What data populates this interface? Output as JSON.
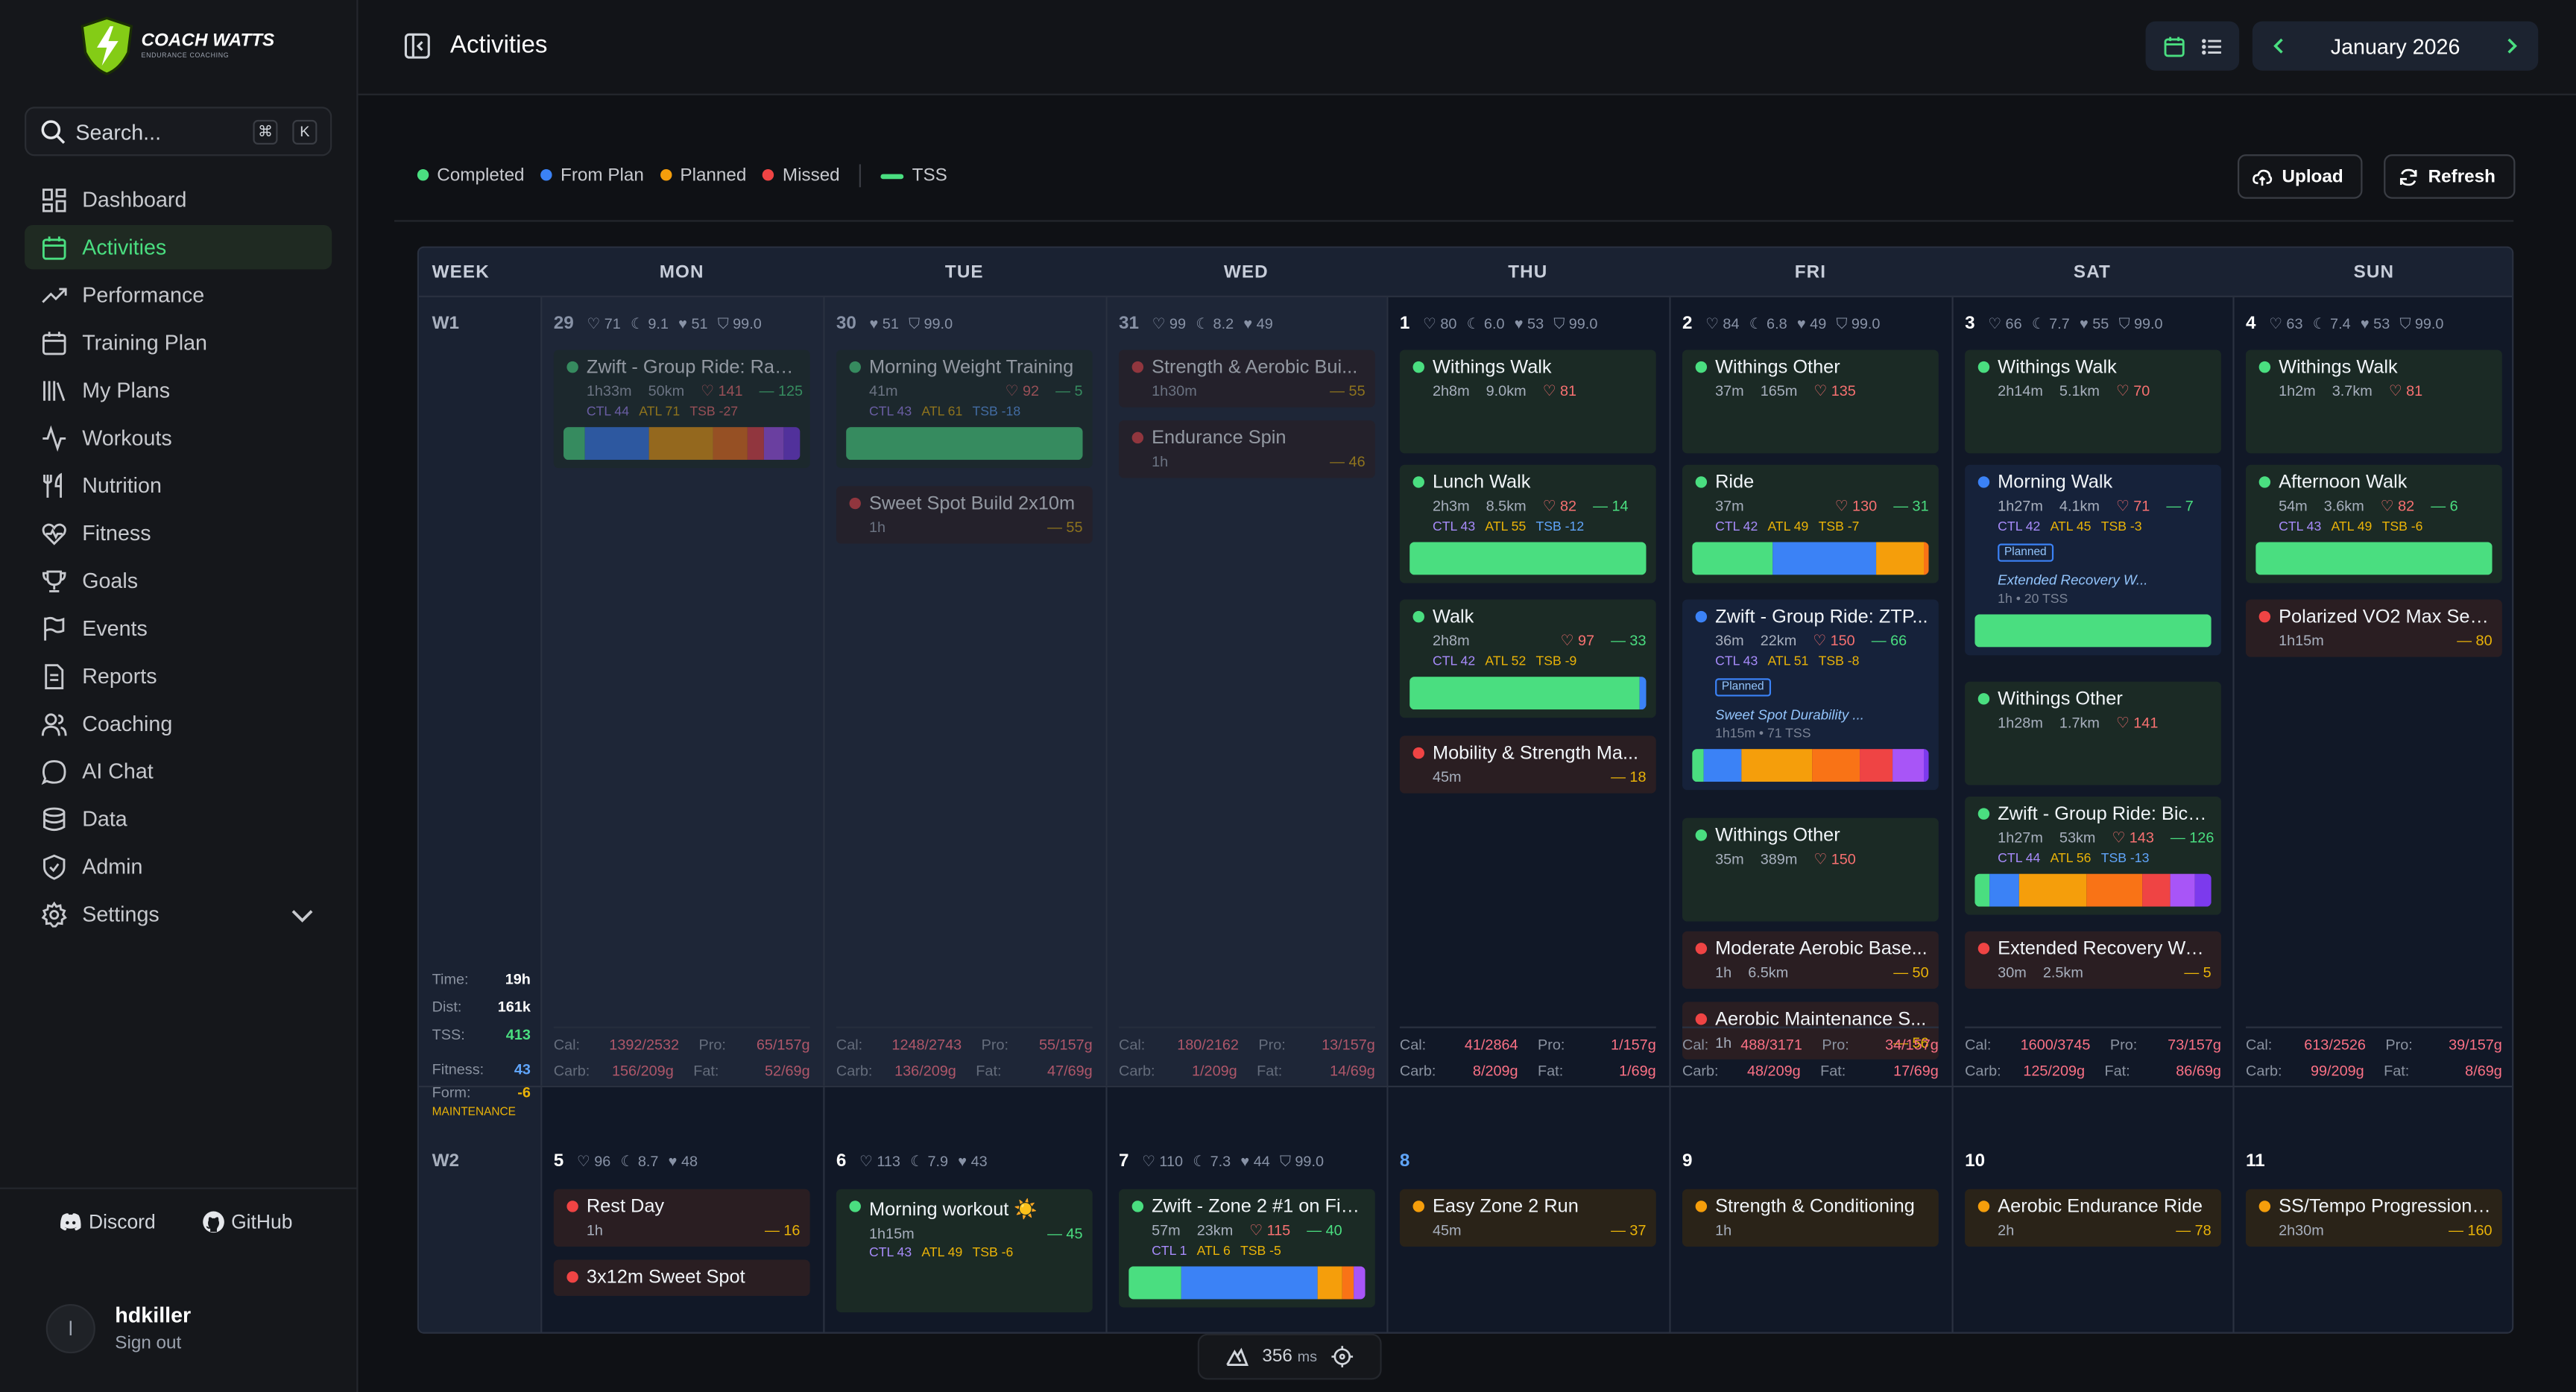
{
  "app": {
    "logo_title": "COACH WATTS",
    "logo_sub": "ENDURANCE COACHING"
  },
  "search": {
    "placeholder": "Search...",
    "kbd1": "⌘",
    "kbd2": "K"
  },
  "nav": [
    {
      "label": "Dashboard",
      "icon": "dashboard-icon"
    },
    {
      "label": "Activities",
      "icon": "calendar-icon",
      "active": true
    },
    {
      "label": "Performance",
      "icon": "trend-icon"
    },
    {
      "label": "Training Plan",
      "icon": "calendar-icon"
    },
    {
      "label": "My Plans",
      "icon": "library-icon"
    },
    {
      "label": "Workouts",
      "icon": "pulse-icon"
    },
    {
      "label": "Nutrition",
      "icon": "utensils-icon"
    },
    {
      "label": "Fitness",
      "icon": "heart-pulse-icon"
    },
    {
      "label": "Goals",
      "icon": "trophy-icon"
    },
    {
      "label": "Events",
      "icon": "flag-icon"
    },
    {
      "label": "Reports",
      "icon": "report-icon"
    },
    {
      "label": "Coaching",
      "icon": "users-icon"
    },
    {
      "label": "AI Chat",
      "icon": "chat-icon"
    },
    {
      "label": "Data",
      "icon": "database-icon"
    },
    {
      "label": "Admin",
      "icon": "shield-icon"
    },
    {
      "label": "Settings",
      "icon": "gear-icon"
    }
  ],
  "links": {
    "discord": "Discord",
    "github": "GitHub"
  },
  "user": {
    "initial": "l",
    "name": "hdkiller",
    "signout": "Sign out"
  },
  "header": {
    "title": "Activities",
    "month": "January 2026"
  },
  "legend": {
    "completed": "Completed",
    "from_plan": "From Plan",
    "planned": "Planned",
    "missed": "Missed",
    "tss": "TSS"
  },
  "buttons": {
    "upload": "Upload",
    "refresh": "Refresh"
  },
  "days": [
    "WEEK",
    "MON",
    "TUE",
    "WED",
    "THU",
    "FRI",
    "SAT",
    "SUN"
  ],
  "colors": {
    "completed": "#4ade80",
    "from_plan": "#3b82f6",
    "planned": "#f59e0b",
    "missed": "#ef4444"
  },
  "week1": {
    "label": "W1",
    "stats": {
      "time_l": "Time:",
      "time": "19h",
      "dist_l": "Dist:",
      "dist": "161k",
      "tss_l": "TSS:",
      "tss": "413",
      "fit_l": "Fitness:",
      "fit": "43",
      "form_l": "Form:",
      "form": "-6",
      "status": "MAINTENANCE"
    },
    "daynums": [
      {
        "n": "29",
        "m": [
          "♡ 71",
          "☾ 9.1",
          "♥ 51",
          "⛉ 99.0"
        ]
      },
      {
        "n": "30",
        "m": [
          "♥ 51",
          "⛉ 99.0"
        ]
      },
      {
        "n": "31",
        "m": [
          "♡ 99",
          "☾ 8.2",
          "♥ 49"
        ]
      },
      {
        "n": "1",
        "m": [
          "♡ 80",
          "☾ 6.0",
          "♥ 53",
          "⛉ 99.0"
        ]
      },
      {
        "n": "2",
        "m": [
          "♡ 84",
          "☾ 6.8",
          "♥ 49",
          "⛉ 99.0"
        ]
      },
      {
        "n": "3",
        "m": [
          "♡ 66",
          "☾ 7.7",
          "♥ 55",
          "⛉ 99.0"
        ]
      },
      {
        "n": "4",
        "m": [
          "♡ 63",
          "☾ 7.4",
          "♥ 53",
          "⛉ 99.0"
        ]
      }
    ],
    "nutrition": [
      {
        "cal": "1392/2532",
        "pro": "65/157g",
        "carb": "156/209g",
        "fat": "52/69g"
      },
      {
        "cal": "1248/2743",
        "pro": "55/157g",
        "carb": "136/209g",
        "fat": "47/69g"
      },
      {
        "cal": "180/2162",
        "pro": "13/157g",
        "carb": "1/209g",
        "fat": "14/69g"
      },
      {
        "cal": "41/2864",
        "pro": "1/157g",
        "carb": "8/209g",
        "fat": "1/69g"
      },
      {
        "cal": "488/3171",
        "pro": "34/157g",
        "carb": "48/209g",
        "fat": "17/69g"
      },
      {
        "cal": "1600/3745",
        "pro": "73/157g",
        "carb": "125/209g",
        "fat": "86/69g"
      },
      {
        "cal": "613/2526",
        "pro": "39/157g",
        "carb": "99/209g",
        "fat": "8/69g"
      }
    ],
    "nutr_labels": {
      "cal": "Cal:",
      "pro": "Pro:",
      "carb": "Carb:",
      "fat": "Fat:"
    }
  },
  "cards": {
    "mon1": {
      "title": "Zwift - Group Ride: Rap...",
      "dur": "1h33m",
      "dist": "50km",
      "hr": "♡ 141",
      "tss": "— 125",
      "ctl": "CTL 44",
      "atl": "ATL 71",
      "tsb": "TSB -27"
    },
    "tue1": {
      "title": "Morning Weight Training",
      "dur": "41m",
      "hr": "♡ 92",
      "tss": "— 5",
      "ctl": "CTL 43",
      "atl": "ATL 61",
      "tsb": "TSB -18"
    },
    "tue2": {
      "title": "Sweet Spot Build 2x10m",
      "dur": "1h",
      "tss": "— 55"
    },
    "wed1": {
      "title": "Strength & Aerobic Bui...",
      "dur": "1h30m",
      "tss": "— 55"
    },
    "wed2": {
      "title": "Endurance Spin",
      "dur": "1h",
      "tss": "— 46"
    },
    "thu1": {
      "title": "Withings Walk",
      "dur": "2h8m",
      "dist": "9.0km",
      "hr": "♡ 81"
    },
    "thu2": {
      "title": "Lunch Walk",
      "dur": "2h3m",
      "dist": "8.5km",
      "hr": "♡ 82",
      "tss": "— 14",
      "ctl": "CTL 43",
      "atl": "ATL 55",
      "tsb": "TSB -12"
    },
    "thu3": {
      "title": "Walk",
      "dur": "2h8m",
      "hr": "♡ 97",
      "tss": "— 33",
      "ctl": "CTL 42",
      "atl": "ATL 52",
      "tsb": "TSB -9"
    },
    "thu4": {
      "title": "Mobility & Strength Ma...",
      "dur": "45m",
      "tss": "— 18"
    },
    "fri1": {
      "title": "Withings Other",
      "dur": "37m",
      "dist": "165m",
      "hr": "♡ 135"
    },
    "fri2": {
      "title": "Ride",
      "dur": "37m",
      "hr": "♡ 130",
      "tss": "— 31",
      "ctl": "CTL 42",
      "atl": "ATL 49",
      "tsb": "TSB -7"
    },
    "fri3": {
      "title": "Zwift - Group Ride: ZTP...",
      "dur": "36m",
      "dist": "22km",
      "hr": "♡ 150",
      "tss": "— 66",
      "ctl": "CTL 43",
      "atl": "ATL 51",
      "tsb": "TSB -8",
      "tag": "Planned",
      "link": "Sweet Spot Durability ...",
      "sub": "1h15m • 71 TSS"
    },
    "fri4": {
      "title": "Withings Other",
      "dur": "35m",
      "dist": "389m",
      "hr": "♡ 150"
    },
    "fri5": {
      "title": "Moderate Aerobic Base...",
      "dur": "1h",
      "dist": "6.5km",
      "tss": "— 50"
    },
    "fri6": {
      "title": "Aerobic Maintenance S...",
      "dur": "1h",
      "tss": "— 56"
    },
    "sat1": {
      "title": "Withings Walk",
      "dur": "2h14m",
      "dist": "5.1km",
      "hr": "♡ 70"
    },
    "sat2": {
      "title": "Morning Walk",
      "dur": "1h27m",
      "dist": "4.1km",
      "hr": "♡ 71",
      "tss": "— 7",
      "ctl": "CTL 42",
      "atl": "ATL 45",
      "tsb": "TSB -3",
      "tag": "Planned",
      "link": "Extended Recovery W...",
      "sub": "1h • 20 TSS"
    },
    "sat3": {
      "title": "Withings Other",
      "dur": "1h28m",
      "dist": "1.7km",
      "hr": "♡ 141"
    },
    "sat4": {
      "title": "Zwift - Group Ride: Bicy...",
      "dur": "1h27m",
      "dist": "53km",
      "hr": "♡ 143",
      "tss": "— 126",
      "ctl": "CTL 44",
      "atl": "ATL 56",
      "tsb": "TSB -13"
    },
    "sat5": {
      "title": "Extended Recovery Wal...",
      "dur": "30m",
      "dist": "2.5km",
      "tss": "— 5"
    },
    "sun1": {
      "title": "Withings Walk",
      "dur": "1h2m",
      "dist": "3.7km",
      "hr": "♡ 81"
    },
    "sun2": {
      "title": "Afternoon Walk",
      "dur": "54m",
      "dist": "3.6km",
      "hr": "♡ 82",
      "tss": "— 6",
      "ctl": "CTL 43",
      "atl": "ATL 49",
      "tsb": "TSB -6"
    },
    "sun3": {
      "title": "Polarized VO2 Max Ses...",
      "dur": "1h15m",
      "tss": "— 80"
    }
  },
  "week2": {
    "label": "W2",
    "daynums": [
      {
        "n": "5",
        "m": [
          "♡ 96",
          "☾ 8.7",
          "♥ 48"
        ]
      },
      {
        "n": "6",
        "m": [
          "♡ 113",
          "☾ 7.9",
          "♥ 43"
        ]
      },
      {
        "n": "7",
        "m": [
          "♡ 110",
          "☾ 7.3",
          "♥ 44",
          "⛉ 99.0"
        ]
      },
      {
        "n": "8",
        "m": []
      },
      {
        "n": "9",
        "m": []
      },
      {
        "n": "10",
        "m": []
      },
      {
        "n": "11",
        "m": []
      }
    ],
    "cards": {
      "mon1": {
        "title": "Rest Day",
        "dur": "1h",
        "tss": "— 16"
      },
      "mon2": {
        "title": "3x12m Sweet Spot"
      },
      "tue1": {
        "title": "Morning workout ☀️",
        "dur": "1h15m",
        "tss": "— 45",
        "ctl": "CTL 43",
        "atl": "ATL 49",
        "tsb": "TSB -6"
      },
      "wed1": {
        "title": "Zwift - Zone 2 #1 on Fig...",
        "dur": "57m",
        "dist": "23km",
        "hr": "♡ 115",
        "tss": "— 40",
        "ctl": "CTL 1",
        "atl": "ATL 6",
        "tsb": "TSB -5"
      },
      "thu1": {
        "title": "Easy Zone 2 Run",
        "dur": "45m",
        "tss": "— 37"
      },
      "fri1": {
        "title": "Strength & Conditioning",
        "dur": "1h"
      },
      "sat1": {
        "title": "Aerobic Endurance Ride",
        "dur": "2h",
        "tss": "— 78"
      },
      "sun1": {
        "title": "SS/Tempo Progression ...",
        "dur": "2h30m",
        "tss": "— 160"
      }
    }
  },
  "footer": {
    "latency": "356",
    "unit": "ms"
  }
}
